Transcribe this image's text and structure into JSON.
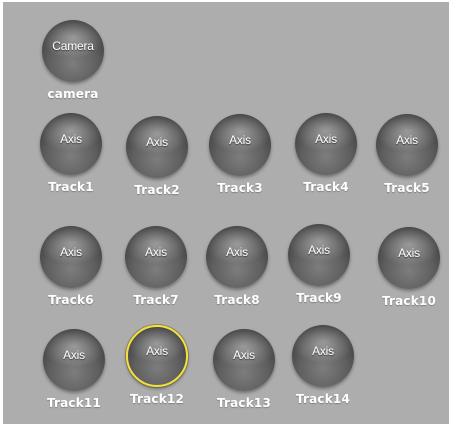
{
  "colors": {
    "background": "#adadad",
    "node_fill": "#5f5f5f",
    "selected_ring": "#f3e13a",
    "text": "#ffffff"
  },
  "camera": {
    "ball_label": "Camera",
    "name": "camera"
  },
  "tracks": [
    {
      "ball_label": "Axis",
      "name": "Track1"
    },
    {
      "ball_label": "Axis",
      "name": "Track2"
    },
    {
      "ball_label": "Axis",
      "name": "Track3"
    },
    {
      "ball_label": "Axis",
      "name": "Track4"
    },
    {
      "ball_label": "Axis",
      "name": "Track5"
    },
    {
      "ball_label": "Axis",
      "name": "Track6"
    },
    {
      "ball_label": "Axis",
      "name": "Track7"
    },
    {
      "ball_label": "Axis",
      "name": "Track8"
    },
    {
      "ball_label": "Axis",
      "name": "Track9"
    },
    {
      "ball_label": "Axis",
      "name": "Track10"
    },
    {
      "ball_label": "Axis",
      "name": "Track11"
    },
    {
      "ball_label": "Axis",
      "name": "Track12",
      "selected": true
    },
    {
      "ball_label": "Axis",
      "name": "Track13"
    },
    {
      "ball_label": "Axis",
      "name": "Track14"
    }
  ]
}
